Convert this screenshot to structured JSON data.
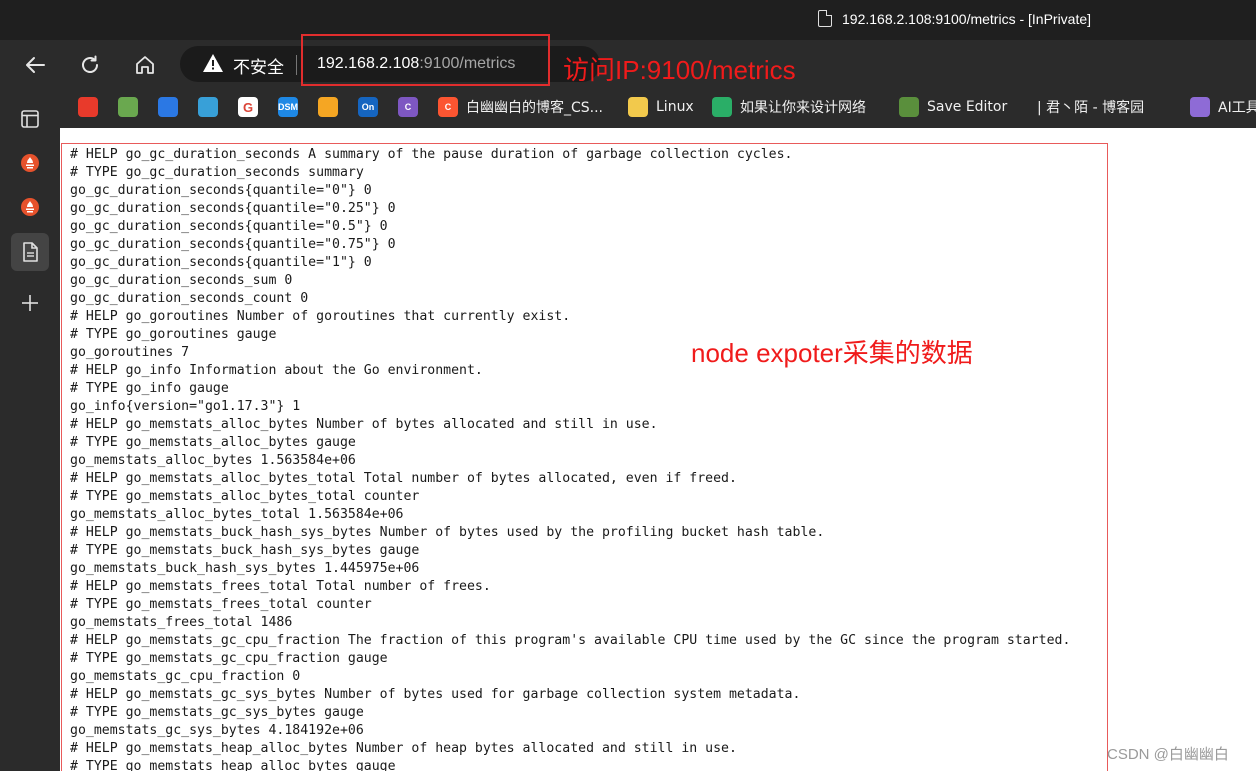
{
  "window": {
    "title": "192.168.2.108:9100/metrics - [InPrivate]"
  },
  "address_bar": {
    "security_label": "不安全",
    "url_host": "192.168.2.108",
    "url_rest": ":9100/metrics"
  },
  "annotations": {
    "url_note": "访问IP:9100/metrics",
    "content_note": "node expoter采集的数据"
  },
  "bookmarks": [
    {
      "label": "",
      "icon": "csdn-app-icon",
      "color": "#e83a2b",
      "text": ""
    },
    {
      "label": "",
      "icon": "frog-icon",
      "color": "#6aa84f",
      "text": ""
    },
    {
      "label": "",
      "icon": "stripes-icon",
      "color": "#2b78e4",
      "text": ""
    },
    {
      "label": "",
      "icon": "waves-icon",
      "color": "#38a0d8",
      "text": ""
    },
    {
      "label": "",
      "icon": "g-icon",
      "color": "#ffffff",
      "text": "G"
    },
    {
      "label": "",
      "icon": "dsm-icon",
      "color": "#1e88e5",
      "text": "DSM"
    },
    {
      "label": "",
      "icon": "cube-icon",
      "color": "#f5a623",
      "text": ""
    },
    {
      "label": "",
      "icon": "on-icon",
      "color": "#1565c0",
      "text": "On"
    },
    {
      "label": "",
      "icon": "c-circle-icon",
      "color": "#7e57c2",
      "text": "C"
    },
    {
      "label": "白幽幽白的博客_CS...",
      "icon": "csdn-c-icon",
      "color": "#fc5531",
      "text": "C"
    },
    {
      "label": "Linux",
      "icon": "folder-icon",
      "color": "#f2c94c",
      "text": ""
    },
    {
      "label": "如果让你来设计网络",
      "icon": "wechat-icon",
      "color": "#2aae67",
      "text": ""
    },
    {
      "label": "Save Editor",
      "icon": "save-editor-icon",
      "color": "#5a8f3c",
      "text": ""
    },
    {
      "label": "| 君丶陌 - 博客园",
      "icon": "blank-icon",
      "color": "#2b2b2b",
      "text": ""
    },
    {
      "label": "AI工具",
      "icon": "ai-icon",
      "color": "#8e6bd6",
      "text": ""
    }
  ],
  "metrics": [
    "# HELP go_gc_duration_seconds A summary of the pause duration of garbage collection cycles.",
    "# TYPE go_gc_duration_seconds summary",
    "go_gc_duration_seconds{quantile=\"0\"} 0",
    "go_gc_duration_seconds{quantile=\"0.25\"} 0",
    "go_gc_duration_seconds{quantile=\"0.5\"} 0",
    "go_gc_duration_seconds{quantile=\"0.75\"} 0",
    "go_gc_duration_seconds{quantile=\"1\"} 0",
    "go_gc_duration_seconds_sum 0",
    "go_gc_duration_seconds_count 0",
    "# HELP go_goroutines Number of goroutines that currently exist.",
    "# TYPE go_goroutines gauge",
    "go_goroutines 7",
    "# HELP go_info Information about the Go environment.",
    "# TYPE go_info gauge",
    "go_info{version=\"go1.17.3\"} 1",
    "# HELP go_memstats_alloc_bytes Number of bytes allocated and still in use.",
    "# TYPE go_memstats_alloc_bytes gauge",
    "go_memstats_alloc_bytes 1.563584e+06",
    "# HELP go_memstats_alloc_bytes_total Total number of bytes allocated, even if freed.",
    "# TYPE go_memstats_alloc_bytes_total counter",
    "go_memstats_alloc_bytes_total 1.563584e+06",
    "# HELP go_memstats_buck_hash_sys_bytes Number of bytes used by the profiling bucket hash table.",
    "# TYPE go_memstats_buck_hash_sys_bytes gauge",
    "go_memstats_buck_hash_sys_bytes 1.445975e+06",
    "# HELP go_memstats_frees_total Total number of frees.",
    "# TYPE go_memstats_frees_total counter",
    "go_memstats_frees_total 1486",
    "# HELP go_memstats_gc_cpu_fraction The fraction of this program's available CPU time used by the GC since the program started.",
    "# TYPE go_memstats_gc_cpu_fraction gauge",
    "go_memstats_gc_cpu_fraction 0",
    "# HELP go_memstats_gc_sys_bytes Number of bytes used for garbage collection system metadata.",
    "# TYPE go_memstats_gc_sys_bytes gauge",
    "go_memstats_gc_sys_bytes 4.184192e+06",
    "# HELP go_memstats_heap_alloc_bytes Number of heap bytes allocated and still in use.",
    "# TYPE go_memstats_heap_alloc_bytes gauge"
  ],
  "watermark": "CSDN @白幽幽白",
  "colors": {
    "annotation": "#f01b1b",
    "content_bg": "#ffffff",
    "chrome_bg": "#2b2b2b"
  }
}
